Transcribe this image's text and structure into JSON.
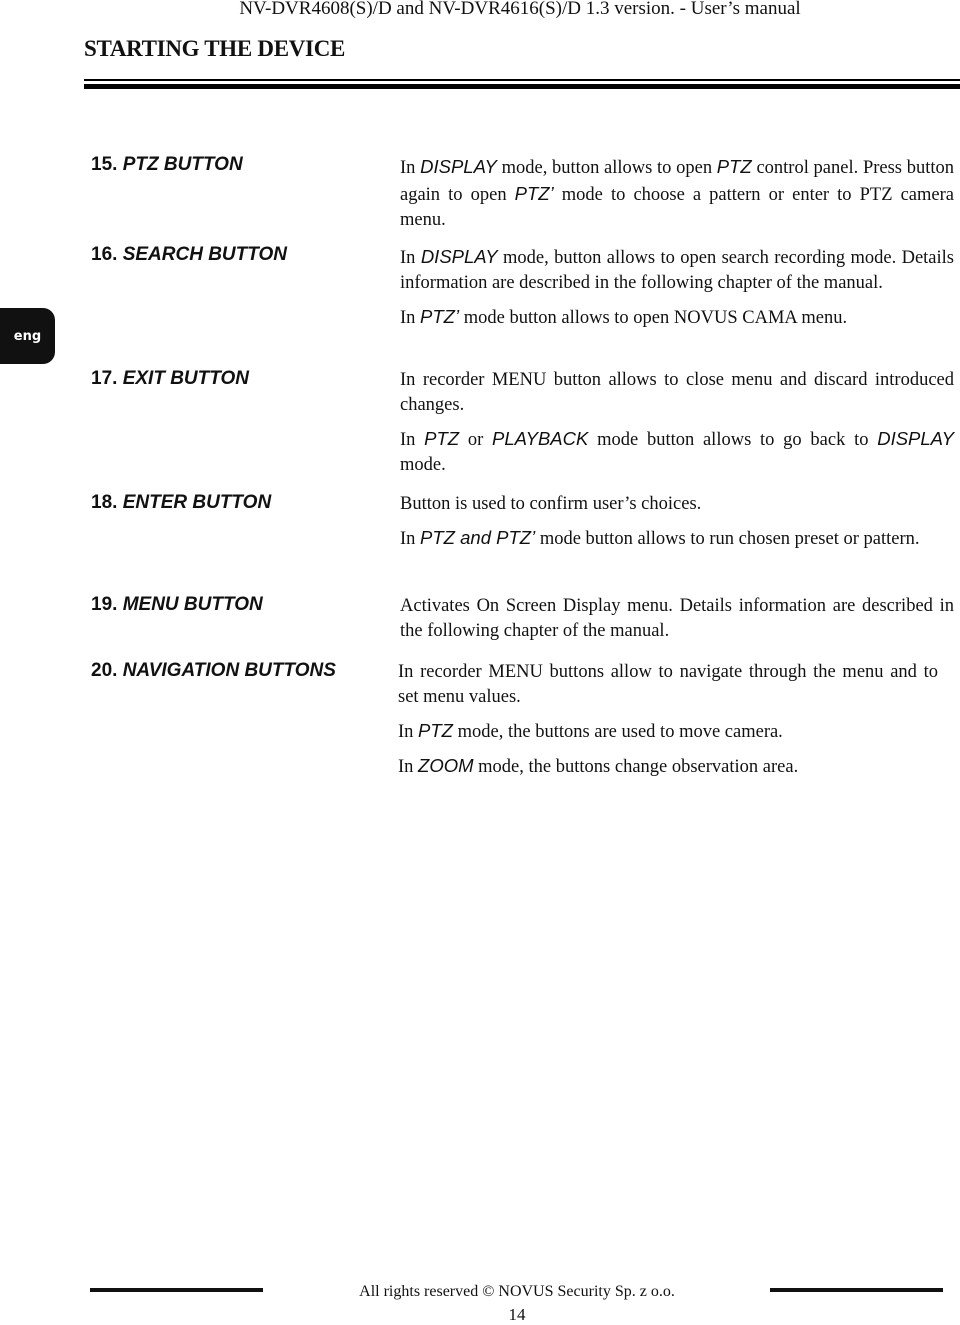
{
  "header": {
    "running_head": "NV-DVR4608(S)/D and NV-DVR4616(S)/D 1.3 version. - User’s manual",
    "section_title": "STARTING THE DEVICE"
  },
  "side_tab": {
    "label": "eng"
  },
  "items": [
    {
      "number": "15.",
      "name": "PTZ BUTTON",
      "paragraphs": [
        [
          {
            "t": "In "
          },
          {
            "t": "DISPLAY",
            "i": true
          },
          {
            "t": " mode, button allows to open "
          },
          {
            "t": "PTZ",
            "i": true
          },
          {
            "t": " control panel. Press button again to open "
          },
          {
            "t": "PTZ’",
            "i": true
          },
          {
            "t": " mode to choose a pattern or enter to PTZ camera menu."
          }
        ]
      ]
    },
    {
      "number": "16.",
      "name": "SEARCH BUTTON",
      "paragraphs": [
        [
          {
            "t": "In "
          },
          {
            "t": "DISPLAY",
            "i": true
          },
          {
            "t": " mode, button allows to open search recording mode. Details information are described in the following chapter of the manual."
          }
        ],
        [
          {
            "t": "In "
          },
          {
            "t": "PTZ’",
            "i": true
          },
          {
            "t": " mode button allows to open NOVUS CAMA menu."
          }
        ]
      ]
    },
    {
      "number": "17.",
      "name": "EXIT BUTTON",
      "paragraphs": [
        [
          {
            "t": "In recorder MENU button allows to close menu and discard introduced changes."
          }
        ],
        [
          {
            "t": "In "
          },
          {
            "t": "PTZ",
            "i": true
          },
          {
            "t": " or "
          },
          {
            "t": "PLAYBACK",
            "i": true
          },
          {
            "t": " mode button allows to go back to "
          },
          {
            "t": "DISPLAY",
            "i": true
          },
          {
            "t": " mode."
          }
        ]
      ]
    },
    {
      "number": "18.",
      "name": "ENTER BUTTON",
      "paragraphs": [
        [
          {
            "t": "Button is used to confirm user’s choices."
          }
        ],
        [
          {
            "t": "In "
          },
          {
            "t": "PTZ and PTZ’",
            "i": true
          },
          {
            "t": " mode button allows to run chosen preset or pattern."
          }
        ]
      ]
    },
    {
      "number": "19.",
      "name": "MENU BUTTON",
      "paragraphs": [
        [
          {
            "t": "Activates On Screen Display menu. Details information are described in the following chapter of the manual."
          }
        ]
      ]
    },
    {
      "number": "20.",
      "name": "NAVIGATION BUTTONS",
      "paragraphs": [
        [
          {
            "t": "In recorder MENU buttons allow to navigate through the menu and to set menu values."
          }
        ],
        [
          {
            "t": "In "
          },
          {
            "t": "PTZ",
            "i": true
          },
          {
            "t": " mode, the buttons are used to move camera."
          }
        ],
        [
          {
            "t": "In "
          },
          {
            "t": "ZOOM",
            "i": true
          },
          {
            "t": " mode, the buttons change observation area."
          }
        ]
      ]
    }
  ],
  "footer": {
    "copyright": "All rights reserved © NOVUS Security Sp. z o.o.",
    "page_number": "14"
  }
}
